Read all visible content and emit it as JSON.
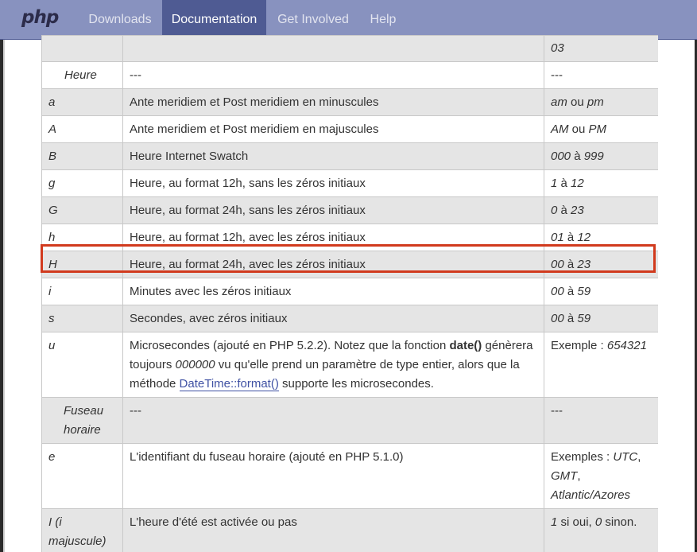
{
  "nav": {
    "logo": "php",
    "items": [
      "Downloads",
      "Documentation",
      "Get Involved",
      "Help"
    ],
    "active": "Documentation"
  },
  "table": {
    "top_partial": {
      "example": "03"
    },
    "rows": [
      {
        "type": "section",
        "format": "Heure",
        "description": "---",
        "example": "---"
      },
      {
        "format": "a",
        "description": "Ante meridiem et Post meridiem en minuscules",
        "example_parts": [
          {
            "t": "am",
            "i": true
          },
          {
            "t": " ou ",
            "i": false
          },
          {
            "t": "pm",
            "i": true
          }
        ]
      },
      {
        "format": "A",
        "description": "Ante meridiem et Post meridiem en majuscules",
        "example_parts": [
          {
            "t": "AM",
            "i": true
          },
          {
            "t": " ou ",
            "i": false
          },
          {
            "t": "PM",
            "i": true
          }
        ]
      },
      {
        "format": "B",
        "description": "Heure Internet Swatch",
        "example_parts": [
          {
            "t": "000",
            "i": true
          },
          {
            "t": " à ",
            "i": false
          },
          {
            "t": "999",
            "i": true
          }
        ]
      },
      {
        "format": "g",
        "description": "Heure, au format 12h, sans les zéros initiaux",
        "example_parts": [
          {
            "t": "1",
            "i": true
          },
          {
            "t": " à ",
            "i": false
          },
          {
            "t": "12",
            "i": true
          }
        ]
      },
      {
        "format": "G",
        "description": "Heure, au format 24h, sans les zéros initiaux",
        "example_parts": [
          {
            "t": "0",
            "i": true
          },
          {
            "t": " à ",
            "i": false
          },
          {
            "t": "23",
            "i": true
          }
        ]
      },
      {
        "format": "h",
        "description": "Heure, au format 12h, avec les zéros initiaux",
        "example_parts": [
          {
            "t": "01",
            "i": true
          },
          {
            "t": " à ",
            "i": false
          },
          {
            "t": "12",
            "i": true
          }
        ]
      },
      {
        "format": "H",
        "description": "Heure, au format 24h, avec les zéros initiaux",
        "example_parts": [
          {
            "t": "00",
            "i": true
          },
          {
            "t": " à ",
            "i": false
          },
          {
            "t": "23",
            "i": true
          }
        ],
        "highlighted": true
      },
      {
        "format": "i",
        "description": "Minutes avec les zéros initiaux",
        "example_parts": [
          {
            "t": "00",
            "i": true
          },
          {
            "t": " à ",
            "i": false
          },
          {
            "t": "59",
            "i": true
          }
        ]
      },
      {
        "format": "s",
        "description": "Secondes, avec zéros initiaux",
        "example_parts": [
          {
            "t": "00",
            "i": true
          },
          {
            "t": " à ",
            "i": false
          },
          {
            "t": "59",
            "i": true
          }
        ]
      },
      {
        "format": "u",
        "description_parts": [
          {
            "t": "Microsecondes (ajouté en PHP 5.2.2). Notez que la fonction ",
            "k": "text"
          },
          {
            "t": "date()",
            "k": "bold"
          },
          {
            "t": " génèrera toujours ",
            "k": "text"
          },
          {
            "t": "000000",
            "k": "italic"
          },
          {
            "t": " vu qu'elle prend un paramètre de type entier, alors que la méthode ",
            "k": "text"
          },
          {
            "t": "DateTime::format()",
            "k": "link"
          },
          {
            "t": " supporte les microsecondes.",
            "k": "text"
          }
        ],
        "example_parts": [
          {
            "t": "Exemple : ",
            "i": false
          },
          {
            "t": "654321",
            "i": true
          }
        ]
      },
      {
        "type": "section",
        "format": "Fuseau horaire",
        "description": "---",
        "example": "---"
      },
      {
        "format": "e",
        "description": "L'identifiant du fuseau horaire (ajouté en PHP 5.1.0)",
        "example_parts": [
          {
            "t": "Exemples : ",
            "i": false
          },
          {
            "t": "UTC",
            "i": true
          },
          {
            "t": ", ",
            "i": false
          },
          {
            "t": "GMT",
            "i": true
          },
          {
            "t": ", ",
            "i": false
          },
          {
            "t": "Atlantic/Azores",
            "i": true
          }
        ]
      },
      {
        "format": "I (i majuscule)",
        "description": "L'heure d'été est activée ou pas",
        "example_parts": [
          {
            "t": "1",
            "i": true
          },
          {
            "t": " si oui, ",
            "i": false
          },
          {
            "t": "0",
            "i": true
          },
          {
            "t": " sinon.",
            "i": false
          }
        ]
      }
    ]
  },
  "colors": {
    "nav_bg": "#8892bf",
    "nav_active": "#4f5b93",
    "row_alt": "#e5e5e5",
    "highlight": "#d13a1d",
    "link": "#3f51a3"
  }
}
